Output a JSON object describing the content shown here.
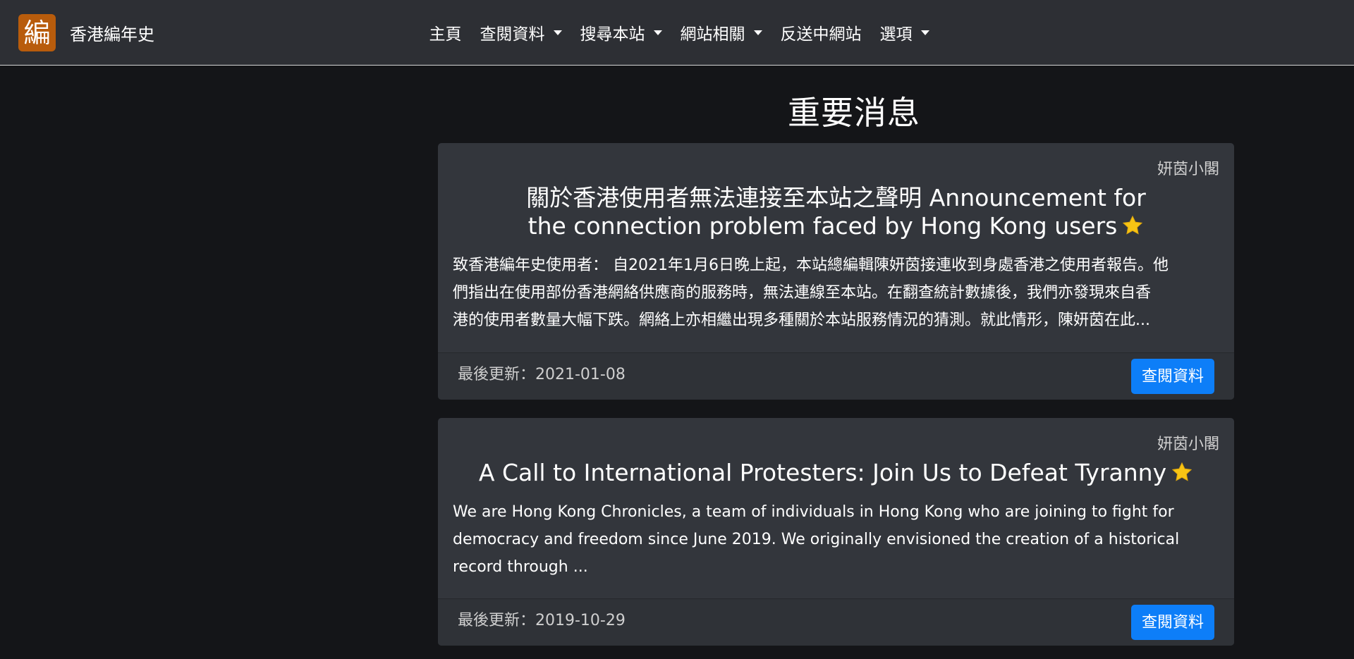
{
  "brand": {
    "logo_char": "編",
    "name": "香港編年史"
  },
  "nav": {
    "items": [
      {
        "label": "主頁",
        "dropdown": false
      },
      {
        "label": "查閱資料",
        "dropdown": true
      },
      {
        "label": "搜尋本站",
        "dropdown": true
      },
      {
        "label": "網站相關",
        "dropdown": true
      },
      {
        "label": "反送中網站",
        "dropdown": false
      },
      {
        "label": "選項",
        "dropdown": true
      }
    ]
  },
  "main": {
    "section_title": "重要消息",
    "cards": [
      {
        "author": "妍茵小閣",
        "title": "關於香港使用者無法連接至本站之聲明 Announcement for the connection problem faced by Hong Kong users",
        "text_lines": [
          "致香港編年史使用者： 自2021年1月6日晚上起，本站總編輯陳妍茵接連收到身處香港之使用者報告。他",
          "們指出在使用部份香港網絡供應商的服務時，無法連線至本站。在翻查統計數據後，我們亦發現來自香",
          "港的使用者數量大幅下跌。網絡上亦相繼出現多種關於本站服務情況的猜測。就此情形，陳妍茵在此..."
        ],
        "updated": "最後更新：2021-01-08",
        "button_label": "查閱資料"
      },
      {
        "author": "妍茵小閣",
        "title": "A Call to International Protesters: Join Us to Defeat Tyranny",
        "text_lines": [
          "We are Hong Kong Chronicles, a team of individuals in Hong Kong who are joining to fight for",
          "democracy and freedom since June 2019. We originally envisioned the creation of a historical",
          "record through ..."
        ],
        "updated": "最後更新：2019-10-29",
        "button_label": "查閱資料"
      }
    ]
  },
  "icons": {
    "star": "star-icon",
    "caret": "chevron-down-icon"
  },
  "colors": {
    "navbar_bg": "#2d2f34",
    "page_bg": "#141518",
    "card_bg": "#33363c",
    "logo_bg": "#b85c0c",
    "button_bg": "#0d7ef8",
    "star": "#f7c414"
  }
}
